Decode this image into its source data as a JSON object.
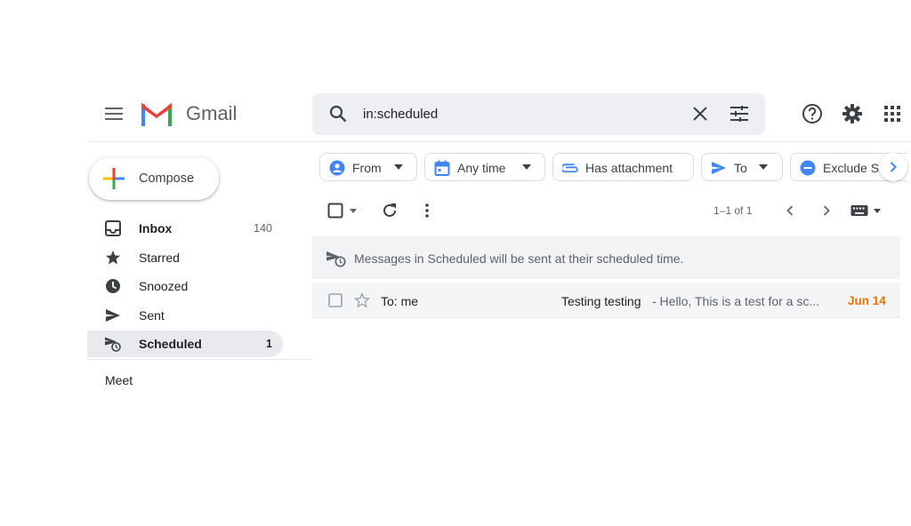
{
  "app": {
    "brand": "Gmail",
    "menu_icon": "hamburger-menu-icon",
    "logo_icon": "gmail-m-logo-icon"
  },
  "search": {
    "value": "in:scheduled",
    "icons": [
      "search-icon",
      "clear-icon",
      "search-options-icon"
    ]
  },
  "header_actions": [
    "help-icon",
    "settings-gear-icon",
    "apps-grid-icon"
  ],
  "compose": {
    "label": "Compose"
  },
  "sidebar": {
    "items": [
      {
        "label": "Inbox",
        "count": "140",
        "icon": "inbox-icon",
        "bold": true
      },
      {
        "label": "Starred",
        "count": "",
        "icon": "star-icon"
      },
      {
        "label": "Snoozed",
        "count": "",
        "icon": "clock-icon"
      },
      {
        "label": "Sent",
        "count": "",
        "icon": "send-icon"
      },
      {
        "label": "Scheduled",
        "count": "1",
        "icon": "scheduled-send-icon",
        "bold": true,
        "active": true
      }
    ],
    "meet_label": "Meet"
  },
  "chips": [
    {
      "label": "From",
      "icon": "person-icon",
      "dropdown": true
    },
    {
      "label": "Any time",
      "icon": "calendar-icon",
      "dropdown": true
    },
    {
      "label": "Has attachment",
      "icon": "paperclip-icon",
      "dropdown": false
    },
    {
      "label": "To",
      "icon": "send-icon",
      "dropdown": true
    },
    {
      "label": "Exclude S",
      "icon": "minus-circle-icon",
      "dropdown": false
    }
  ],
  "toolbar": {
    "range": "1–1 of 1"
  },
  "info_banner": {
    "text": "Messages in Scheduled will be sent at their scheduled time."
  },
  "emails": [
    {
      "sender": "To: me",
      "subject": "Testing testing",
      "snippet": " - Hello, This is a test for a sc...",
      "date": "Jun 14"
    }
  ],
  "colors": {
    "accent_blue": "#4285f4",
    "date_orange": "#e37400",
    "active_bg": "#e8eaed",
    "gmail_red": "#ea4335"
  }
}
